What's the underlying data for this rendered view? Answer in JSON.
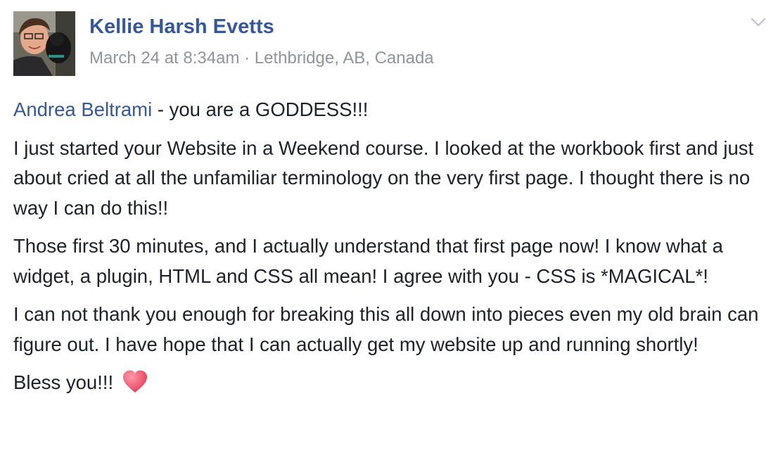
{
  "post": {
    "author": "Kellie Harsh Evetts",
    "timestamp": "March 24 at 8:34am",
    "separator": " · ",
    "location": "Lethbridge, AB, Canada",
    "menu_icon": "chevron-down-icon",
    "mention": "Andrea Beltrami",
    "line1_rest": " - you are a GODDESS!!!",
    "paragraph2": "I just started your Website in a Weekend course. I looked at the workbook first and just about cried at all the unfamiliar terminology on the very first page. I thought there is no way I can do this!!",
    "paragraph3": "Those first 30 minutes, and I actually understand that first page now! I know what a widget, a plugin, HTML and CSS all mean! I agree with you - CSS is *MAGICAL*!",
    "paragraph4": "I can not thank you enough for breaking this all down into pieces even my old brain can figure out. I have hope that I can actually get my website up and running shortly!",
    "closing": "Bless you!!!",
    "closing_emoji": "heart-icon"
  },
  "colors": {
    "link": "#365899",
    "meta": "#90949c",
    "text": "#1d2129",
    "heart": "#e8536b"
  }
}
